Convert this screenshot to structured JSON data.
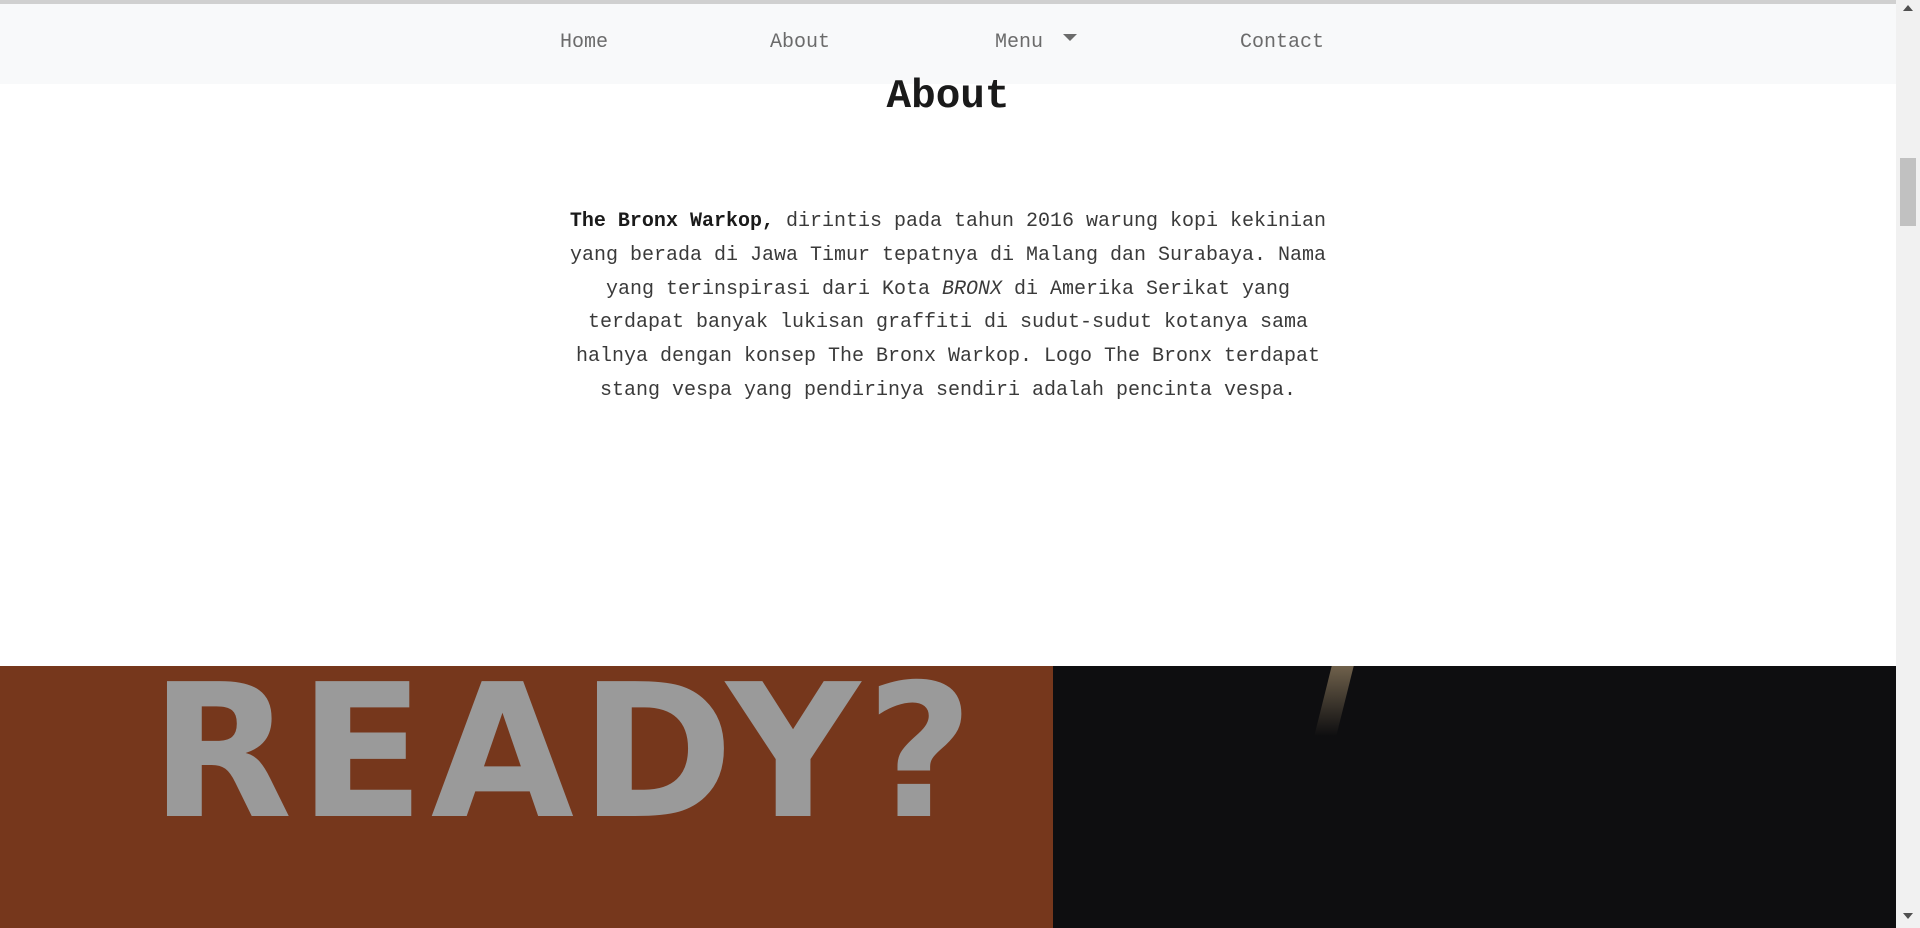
{
  "nav": {
    "items": [
      {
        "label": "Home"
      },
      {
        "label": "About"
      },
      {
        "label": "Menu"
      },
      {
        "label": "Contact"
      }
    ]
  },
  "about": {
    "title": "About",
    "brand": "The Bronx Warkop,",
    "text_part1": " dirintis pada tahun 2016 warung kopi kekinian yang berada di Jawa Timur tepatnya di Malang dan Surabaya. Nama yang terinspirasi dari Kota ",
    "city_emphasis": "BRONX",
    "text_part2": " di Amerika Serikat yang terdapat banyak lukisan graffiti di sudut-sudut kotanya sama halnya dengan konsep The Bronx Warkop. Logo The Bronx terdapat stang vespa yang pendirinya sendiri adalah pencinta vespa."
  },
  "hero": {
    "ready_text": "READY?",
    "left_bg_color": "#76371c",
    "right_bg_color": "#0e0e10"
  },
  "icons": {
    "menu_caret": "caret-down-icon",
    "scroll_up": "scroll-up-arrow-icon",
    "scroll_down": "scroll-down-arrow-icon"
  }
}
